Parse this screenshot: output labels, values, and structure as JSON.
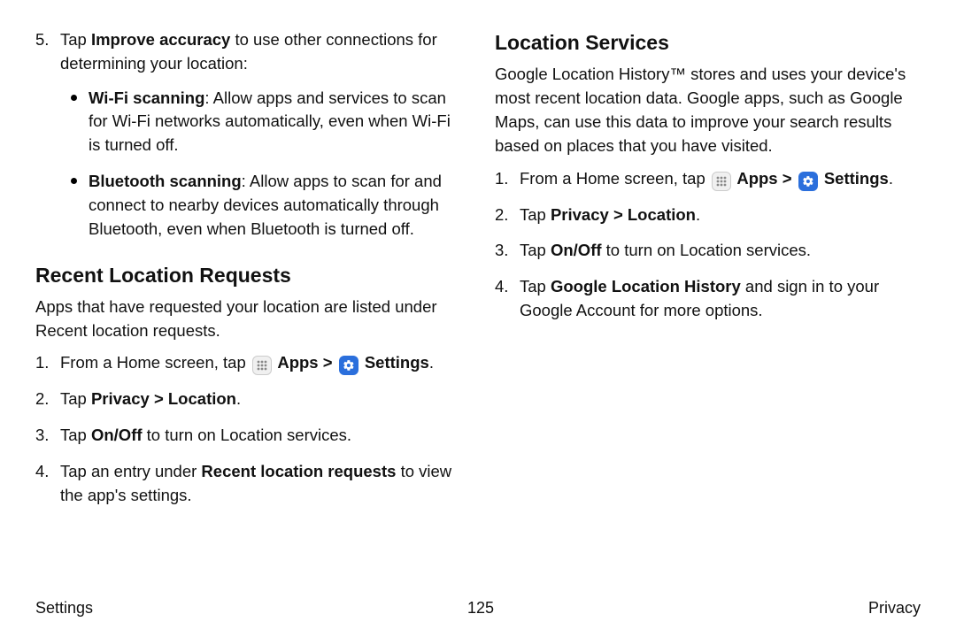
{
  "left": {
    "item5_num": "5.",
    "item5_pre": "Tap ",
    "item5_bold": "Improve accuracy",
    "item5_post": " to use other connections for determining your location:",
    "bullet1_bold": "Wi-Fi scanning",
    "bullet1_rest": ": Allow apps and services to scan for Wi-Fi networks automatically, even when Wi-Fi is turned off.",
    "bullet2_bold": "Bluetooth scanning",
    "bullet2_rest": ": Allow apps to scan for and connect to nearby devices automatically through Bluetooth, even when Bluetooth is turned off.",
    "heading": "Recent Location Requests",
    "intro": "Apps that have requested your location are listed under Recent location requests.",
    "s1_num": "1.",
    "s1_pre": "From a Home screen, tap ",
    "s1_apps": " Apps",
    "s1_gt": " > ",
    "s1_settings": " Settings",
    "s1_end": ".",
    "s2_num": "2.",
    "s2_pre": "Tap ",
    "s2_bold": "Privacy > Location",
    "s2_end": ".",
    "s3_num": "3.",
    "s3_pre": "Tap ",
    "s3_bold": "On/Off",
    "s3_post": " to turn on Location services.",
    "s4_num": "4.",
    "s4_pre": "Tap an entry under ",
    "s4_bold": "Recent location requests",
    "s4_post": " to view the app's settings."
  },
  "right": {
    "heading": "Location Services",
    "intro": "Google Location History™ stores and uses your device's most recent location data. Google apps, such as Google Maps, can use this data to improve your search results based on places that you have visited.",
    "s1_num": "1.",
    "s1_pre": "From a Home screen, tap ",
    "s1_apps": " Apps",
    "s1_gt": " > ",
    "s1_settings": " Settings",
    "s1_end": ".",
    "s2_num": "2.",
    "s2_pre": "Tap ",
    "s2_bold": "Privacy > Location",
    "s2_end": ".",
    "s3_num": "3.",
    "s3_pre": "Tap ",
    "s3_bold": "On/Off",
    "s3_post": " to turn on Location services.",
    "s4_num": "4.",
    "s4_pre": "Tap ",
    "s4_bold": "Google Location History",
    "s4_post": " and sign in to your Google Account for more options."
  },
  "footer": {
    "left": "Settings",
    "center": "125",
    "right": "Privacy"
  }
}
